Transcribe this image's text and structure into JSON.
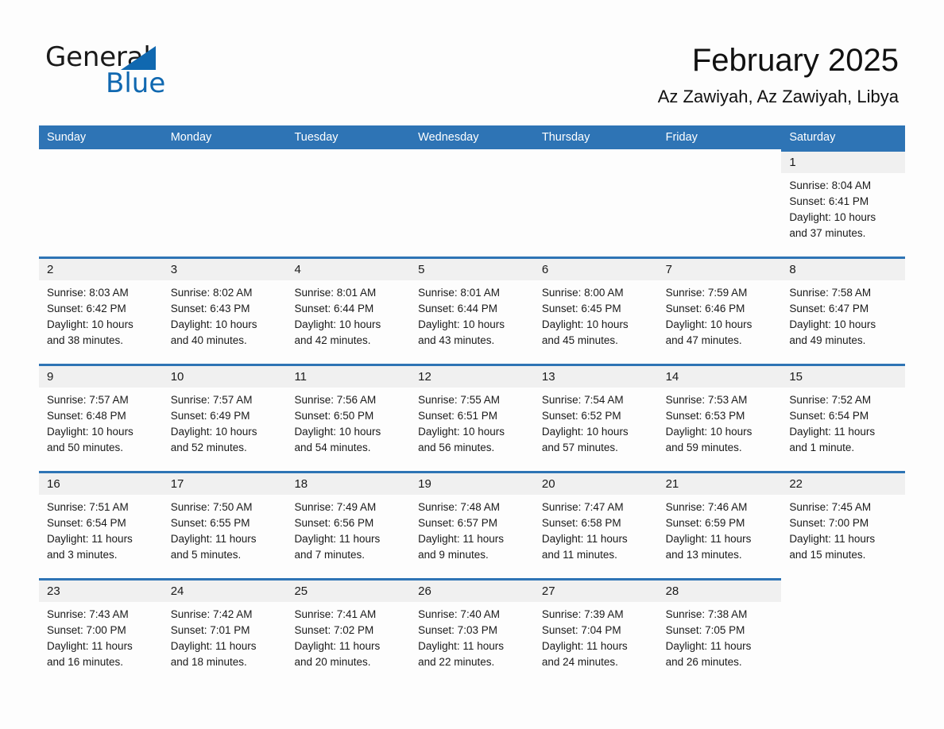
{
  "brand": {
    "name_part1": "General",
    "name_part2": "Blue",
    "triangle_color": "#1068b0",
    "blue_color": "#1068b0"
  },
  "header": {
    "title": "February 2025",
    "location": "Az Zawiyah, Az Zawiyah, Libya"
  },
  "theme": {
    "header_blue": "#2e74b5",
    "day_band_gray": "#f0f0f0",
    "page_background": "#fdfdfd",
    "text_color": "#1a1a1a"
  },
  "calendar": {
    "weekdays": [
      "Sunday",
      "Monday",
      "Tuesday",
      "Wednesday",
      "Thursday",
      "Friday",
      "Saturday"
    ],
    "weeks": [
      [
        {
          "day": "",
          "empty": true
        },
        {
          "day": "",
          "empty": true
        },
        {
          "day": "",
          "empty": true
        },
        {
          "day": "",
          "empty": true
        },
        {
          "day": "",
          "empty": true
        },
        {
          "day": "",
          "empty": true
        },
        {
          "day": "1",
          "sunrise": "Sunrise: 8:04 AM",
          "sunset": "Sunset: 6:41 PM",
          "daylight1": "Daylight: 10 hours",
          "daylight2": "and 37 minutes."
        }
      ],
      [
        {
          "day": "2",
          "sunrise": "Sunrise: 8:03 AM",
          "sunset": "Sunset: 6:42 PM",
          "daylight1": "Daylight: 10 hours",
          "daylight2": "and 38 minutes."
        },
        {
          "day": "3",
          "sunrise": "Sunrise: 8:02 AM",
          "sunset": "Sunset: 6:43 PM",
          "daylight1": "Daylight: 10 hours",
          "daylight2": "and 40 minutes."
        },
        {
          "day": "4",
          "sunrise": "Sunrise: 8:01 AM",
          "sunset": "Sunset: 6:44 PM",
          "daylight1": "Daylight: 10 hours",
          "daylight2": "and 42 minutes."
        },
        {
          "day": "5",
          "sunrise": "Sunrise: 8:01 AM",
          "sunset": "Sunset: 6:44 PM",
          "daylight1": "Daylight: 10 hours",
          "daylight2": "and 43 minutes."
        },
        {
          "day": "6",
          "sunrise": "Sunrise: 8:00 AM",
          "sunset": "Sunset: 6:45 PM",
          "daylight1": "Daylight: 10 hours",
          "daylight2": "and 45 minutes."
        },
        {
          "day": "7",
          "sunrise": "Sunrise: 7:59 AM",
          "sunset": "Sunset: 6:46 PM",
          "daylight1": "Daylight: 10 hours",
          "daylight2": "and 47 minutes."
        },
        {
          "day": "8",
          "sunrise": "Sunrise: 7:58 AM",
          "sunset": "Sunset: 6:47 PM",
          "daylight1": "Daylight: 10 hours",
          "daylight2": "and 49 minutes."
        }
      ],
      [
        {
          "day": "9",
          "sunrise": "Sunrise: 7:57 AM",
          "sunset": "Sunset: 6:48 PM",
          "daylight1": "Daylight: 10 hours",
          "daylight2": "and 50 minutes."
        },
        {
          "day": "10",
          "sunrise": "Sunrise: 7:57 AM",
          "sunset": "Sunset: 6:49 PM",
          "daylight1": "Daylight: 10 hours",
          "daylight2": "and 52 minutes."
        },
        {
          "day": "11",
          "sunrise": "Sunrise: 7:56 AM",
          "sunset": "Sunset: 6:50 PM",
          "daylight1": "Daylight: 10 hours",
          "daylight2": "and 54 minutes."
        },
        {
          "day": "12",
          "sunrise": "Sunrise: 7:55 AM",
          "sunset": "Sunset: 6:51 PM",
          "daylight1": "Daylight: 10 hours",
          "daylight2": "and 56 minutes."
        },
        {
          "day": "13",
          "sunrise": "Sunrise: 7:54 AM",
          "sunset": "Sunset: 6:52 PM",
          "daylight1": "Daylight: 10 hours",
          "daylight2": "and 57 minutes."
        },
        {
          "day": "14",
          "sunrise": "Sunrise: 7:53 AM",
          "sunset": "Sunset: 6:53 PM",
          "daylight1": "Daylight: 10 hours",
          "daylight2": "and 59 minutes."
        },
        {
          "day": "15",
          "sunrise": "Sunrise: 7:52 AM",
          "sunset": "Sunset: 6:54 PM",
          "daylight1": "Daylight: 11 hours",
          "daylight2": "and 1 minute."
        }
      ],
      [
        {
          "day": "16",
          "sunrise": "Sunrise: 7:51 AM",
          "sunset": "Sunset: 6:54 PM",
          "daylight1": "Daylight: 11 hours",
          "daylight2": "and 3 minutes."
        },
        {
          "day": "17",
          "sunrise": "Sunrise: 7:50 AM",
          "sunset": "Sunset: 6:55 PM",
          "daylight1": "Daylight: 11 hours",
          "daylight2": "and 5 minutes."
        },
        {
          "day": "18",
          "sunrise": "Sunrise: 7:49 AM",
          "sunset": "Sunset: 6:56 PM",
          "daylight1": "Daylight: 11 hours",
          "daylight2": "and 7 minutes."
        },
        {
          "day": "19",
          "sunrise": "Sunrise: 7:48 AM",
          "sunset": "Sunset: 6:57 PM",
          "daylight1": "Daylight: 11 hours",
          "daylight2": "and 9 minutes."
        },
        {
          "day": "20",
          "sunrise": "Sunrise: 7:47 AM",
          "sunset": "Sunset: 6:58 PM",
          "daylight1": "Daylight: 11 hours",
          "daylight2": "and 11 minutes."
        },
        {
          "day": "21",
          "sunrise": "Sunrise: 7:46 AM",
          "sunset": "Sunset: 6:59 PM",
          "daylight1": "Daylight: 11 hours",
          "daylight2": "and 13 minutes."
        },
        {
          "day": "22",
          "sunrise": "Sunrise: 7:45 AM",
          "sunset": "Sunset: 7:00 PM",
          "daylight1": "Daylight: 11 hours",
          "daylight2": "and 15 minutes."
        }
      ],
      [
        {
          "day": "23",
          "sunrise": "Sunrise: 7:43 AM",
          "sunset": "Sunset: 7:00 PM",
          "daylight1": "Daylight: 11 hours",
          "daylight2": "and 16 minutes."
        },
        {
          "day": "24",
          "sunrise": "Sunrise: 7:42 AM",
          "sunset": "Sunset: 7:01 PM",
          "daylight1": "Daylight: 11 hours",
          "daylight2": "and 18 minutes."
        },
        {
          "day": "25",
          "sunrise": "Sunrise: 7:41 AM",
          "sunset": "Sunset: 7:02 PM",
          "daylight1": "Daylight: 11 hours",
          "daylight2": "and 20 minutes."
        },
        {
          "day": "26",
          "sunrise": "Sunrise: 7:40 AM",
          "sunset": "Sunset: 7:03 PM",
          "daylight1": "Daylight: 11 hours",
          "daylight2": "and 22 minutes."
        },
        {
          "day": "27",
          "sunrise": "Sunrise: 7:39 AM",
          "sunset": "Sunset: 7:04 PM",
          "daylight1": "Daylight: 11 hours",
          "daylight2": "and 24 minutes."
        },
        {
          "day": "28",
          "sunrise": "Sunrise: 7:38 AM",
          "sunset": "Sunset: 7:05 PM",
          "daylight1": "Daylight: 11 hours",
          "daylight2": "and 26 minutes."
        },
        {
          "day": "",
          "empty": true
        }
      ]
    ]
  }
}
